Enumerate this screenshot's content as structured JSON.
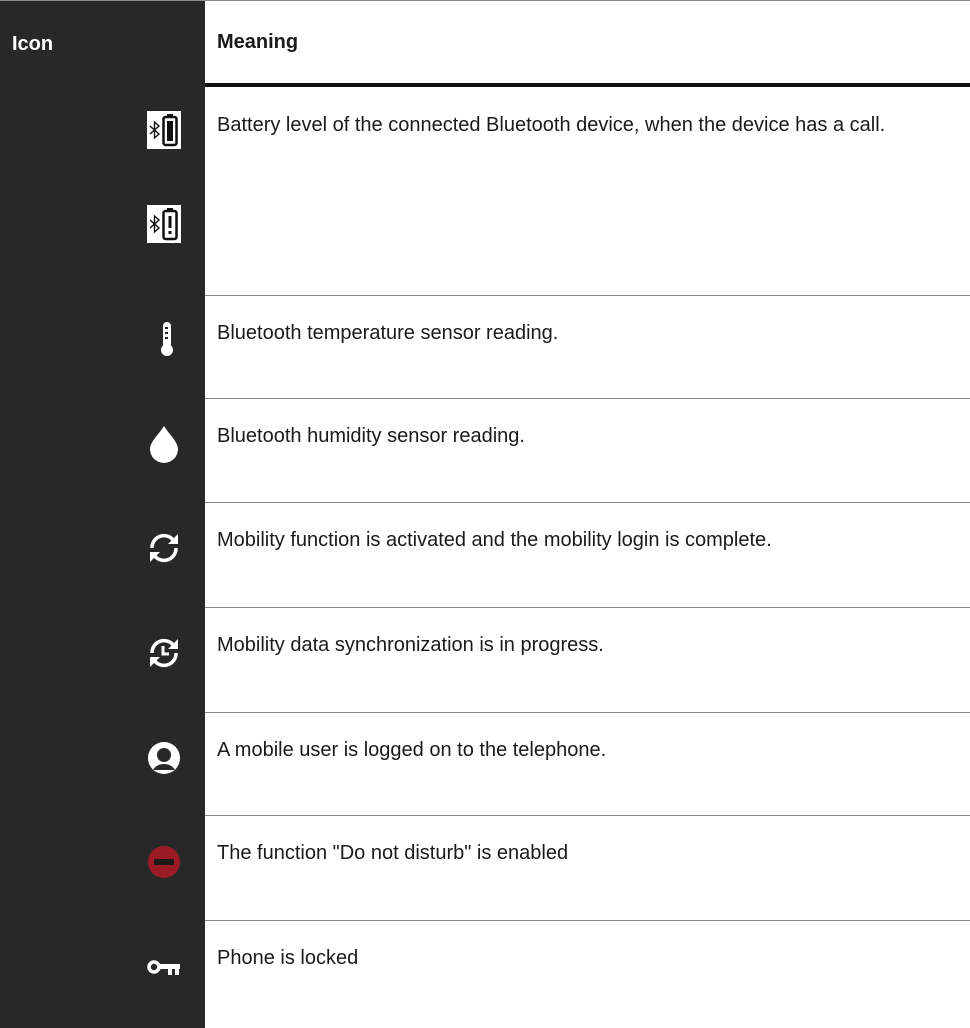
{
  "table": {
    "header": {
      "icon": "Icon",
      "meaning": "Meaning"
    },
    "rows": [
      {
        "icons": [
          "bluetooth-battery-icon",
          "bluetooth-battery-warning-icon"
        ],
        "meaning": "Battery level of the connected Bluetooth device, when the device has a call."
      },
      {
        "icons": [
          "thermometer-icon"
        ],
        "meaning": "Bluetooth temperature sensor reading."
      },
      {
        "icons": [
          "humidity-drop-icon"
        ],
        "meaning": "Bluetooth humidity sensor reading."
      },
      {
        "icons": [
          "mobility-sync-icon"
        ],
        "meaning": "Mobility function is activated and the mobility login is complete."
      },
      {
        "icons": [
          "mobility-sync-progress-icon"
        ],
        "meaning": "Mobility data synchronization is in progress."
      },
      {
        "icons": [
          "mobile-user-icon"
        ],
        "meaning": "A mobile user is logged on to the telephone."
      },
      {
        "icons": [
          "do-not-disturb-icon"
        ],
        "meaning": "The function \"Do not disturb\" is enabled"
      },
      {
        "icons": [
          "key-lock-icon"
        ],
        "meaning": "Phone is locked"
      }
    ]
  },
  "colors": {
    "icon_column_bg": "#282828",
    "do_not_disturb": "#9b1b25",
    "row_divider": "#8c8c8c"
  }
}
